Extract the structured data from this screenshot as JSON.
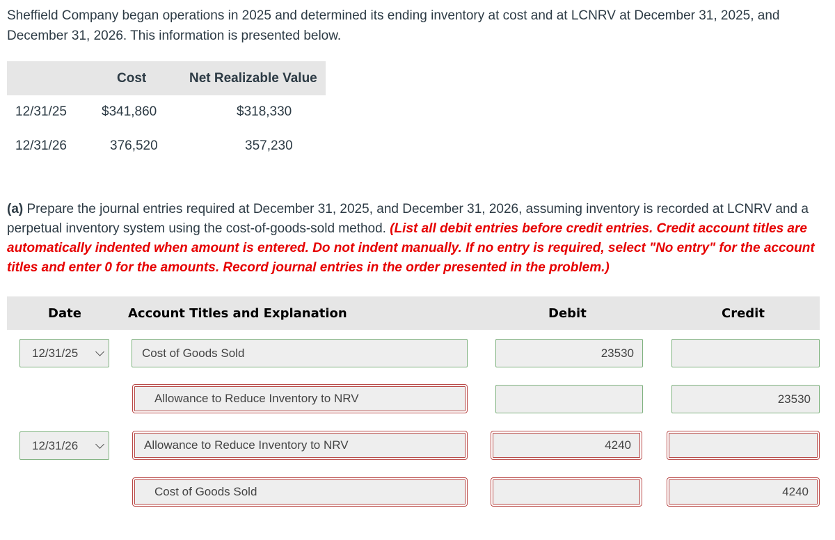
{
  "intro": "Sheffield Company began operations in 2025 and determined its ending inventory at cost and at LCNRV at December 31, 2025, and December 31, 2026. This information is presented below.",
  "inventory_table": {
    "headers": [
      "",
      "Cost",
      "Net Realizable Value"
    ],
    "rows": [
      {
        "date": "12/31/25",
        "cost": "$341,860",
        "nrv": "$318,330"
      },
      {
        "date": "12/31/26",
        "cost": "376,520",
        "nrv": "357,230"
      }
    ]
  },
  "question": {
    "prefix": "(a)",
    "text": " Prepare the journal entries required at December 31, 2025, and December 31, 2026, assuming inventory is recorded at LCNRV and a perpetual inventory system using the cost-of-goods-sold method. ",
    "instructions": "(List all debit entries before credit entries. Credit account titles are automatically indented when amount is entered. Do not indent manually. If no entry is required, select \"No entry\" for the account titles and enter 0 for the amounts. Record journal entries in the order presented in the problem.)"
  },
  "journal": {
    "headers": {
      "date": "Date",
      "account": "Account Titles and Explanation",
      "debit": "Debit",
      "credit": "Credit"
    },
    "rows": [
      {
        "date": "12/31/25",
        "account": "Cost of Goods Sold",
        "debit": "23530",
        "credit": "",
        "status": "correct"
      },
      {
        "date": "",
        "account": "Allowance to Reduce Inventory to NRV",
        "debit": "",
        "credit": "23530",
        "status": "mixed"
      },
      {
        "date": "12/31/26",
        "account": "Allowance to Reduce Inventory to NRV",
        "debit": "4240",
        "credit": "",
        "status": "incorrect"
      },
      {
        "date": "",
        "account": "Cost of Goods Sold",
        "debit": "",
        "credit": "4240",
        "status": "incorrect"
      }
    ]
  },
  "colors": {
    "correct_border": "#7fb27f",
    "incorrect_border": "#b94a48",
    "instruction_red": "#e60000",
    "header_bg": "#e6e6e6"
  }
}
